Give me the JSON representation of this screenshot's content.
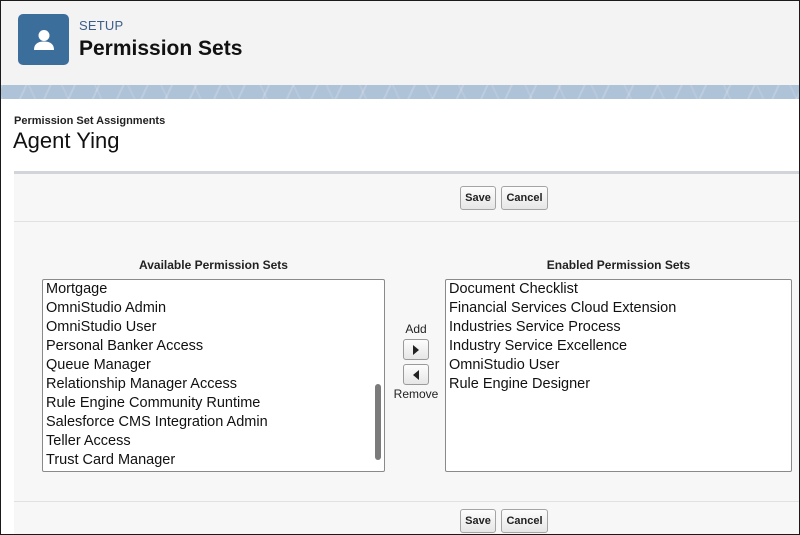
{
  "header": {
    "section": "SETUP",
    "title": "Permission Sets",
    "icon": "user-icon"
  },
  "assignment": {
    "label": "Permission Set Assignments",
    "user_name": "Agent Ying"
  },
  "buttons": {
    "save": "Save",
    "cancel": "Cancel"
  },
  "available": {
    "heading": "Available Permission Sets",
    "items": [
      "Mortgage",
      "OmniStudio Admin",
      "OmniStudio User",
      "Personal Banker Access",
      "Queue Manager",
      "Relationship Manager Access",
      "Rule Engine Community Runtime",
      "Salesforce CMS Integration Admin",
      "Teller Access",
      "Trust Card Manager"
    ]
  },
  "enabled": {
    "heading": "Enabled Permission Sets",
    "items": [
      "Document Checklist",
      "Financial Services Cloud Extension",
      "Industries Service Process",
      "Industry Service Excellence",
      "OmniStudio User",
      "Rule Engine Designer"
    ]
  },
  "move": {
    "add_label": "Add",
    "remove_label": "Remove",
    "add_icon": "arrow-right-icon",
    "remove_icon": "arrow-left-icon"
  },
  "colors": {
    "header_icon_bg": "#3c6e9c",
    "banner": "#aec2d8",
    "setup_text": "#3c5f8a"
  }
}
